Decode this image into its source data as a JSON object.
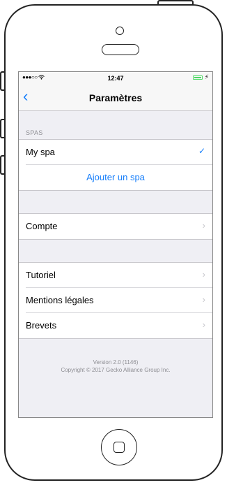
{
  "status_bar": {
    "signal": "●●●○○",
    "time": "12:47",
    "charging": "⚡"
  },
  "nav": {
    "back_glyph": "‹",
    "title": "Paramètres"
  },
  "spas_section": {
    "header": "SPAS",
    "selected_spa": "My spa",
    "check_glyph": "✓",
    "add_label": "Ajouter un spa"
  },
  "account_row": {
    "label": "Compte"
  },
  "info_rows": [
    {
      "label": "Tutoriel"
    },
    {
      "label": "Mentions légales"
    },
    {
      "label": "Brevets"
    }
  ],
  "chevron_glyph": "›",
  "footer": {
    "version": "Version 2.0 (1146)",
    "copyright": "Copyright © 2017 Gecko Alliance Group Inc."
  },
  "colors": {
    "accent": "#157efb",
    "background": "#efeff4",
    "secondary_text": "#8e8e93",
    "battery": "#4cd964"
  },
  "icons": {
    "back": "chevron-left-icon",
    "disclosure": "chevron-right-icon",
    "selected": "checkmark-icon",
    "wifi": "wifi-icon",
    "battery": "battery-icon"
  }
}
